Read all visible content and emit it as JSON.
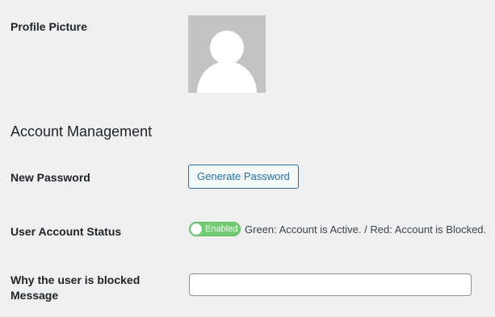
{
  "profile_picture": {
    "label": "Profile Picture",
    "avatar_icon": "default-user-avatar-icon"
  },
  "account_management": {
    "title": "Account Management",
    "new_password": {
      "label": "New Password",
      "button_label": "Generate Password"
    },
    "user_account_status": {
      "label": "User Account Status",
      "toggle_state": true,
      "toggle_label": "Enabled",
      "toggle_color": "#6fcf6f",
      "description": "Green: Account is Active. / Red: Account is Blocked."
    },
    "blocked_message": {
      "label_line1": "Why the user is blocked",
      "label_line2": "Message",
      "value": ""
    }
  }
}
